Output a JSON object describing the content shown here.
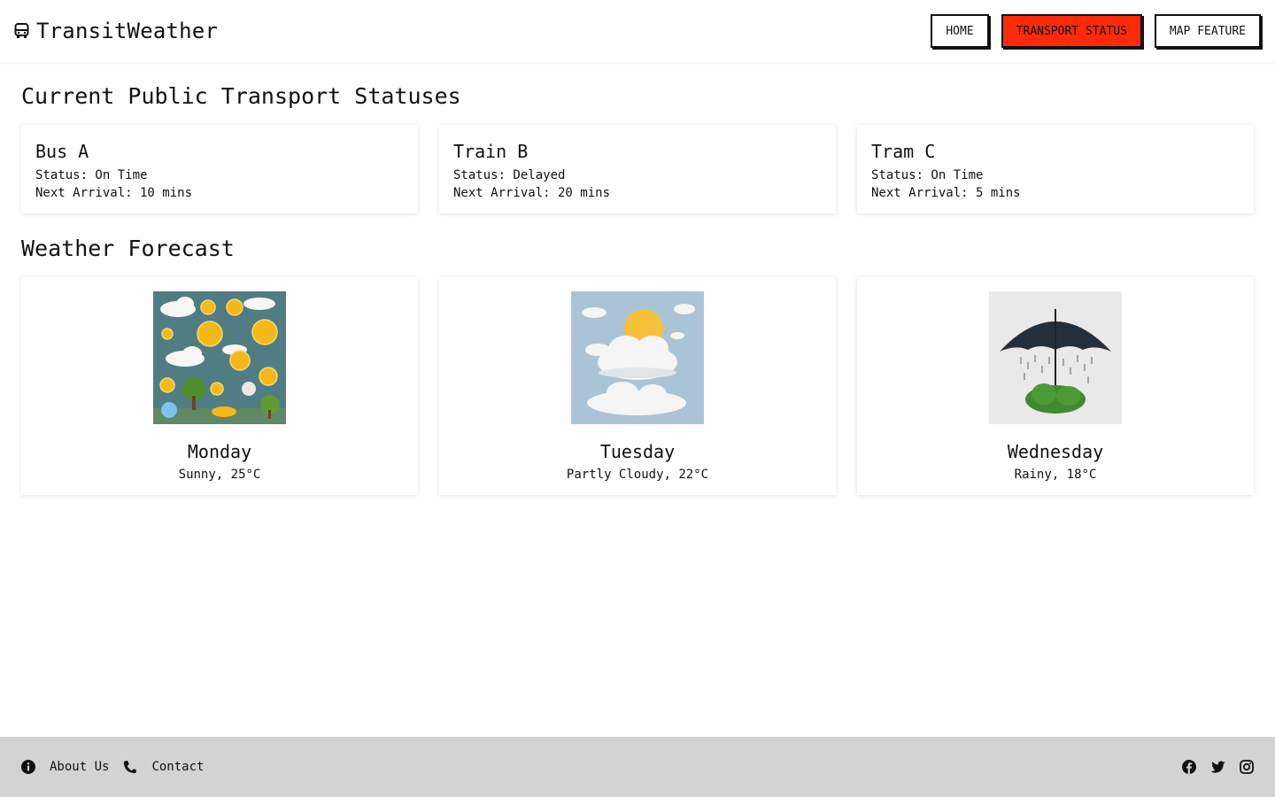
{
  "header": {
    "brand": "TransitWeather",
    "brand_icon": "bus-icon",
    "nav": [
      {
        "label": "HOME",
        "active": false
      },
      {
        "label": "TRANSPORT STATUS",
        "active": true
      },
      {
        "label": "MAP FEATURE",
        "active": false
      }
    ],
    "accent_color": "#ff2a0a"
  },
  "transport": {
    "title": "Current Public Transport Statuses",
    "items": [
      {
        "name": "Bus A",
        "status": "Status: On Time",
        "arrival": "Next Arrival: 10 mins"
      },
      {
        "name": "Train B",
        "status": "Status: Delayed",
        "arrival": "Next Arrival: 20 mins"
      },
      {
        "name": "Tram C",
        "status": "Status: On Time",
        "arrival": "Next Arrival: 5 mins"
      }
    ]
  },
  "weather": {
    "title": "Weather Forecast",
    "days": [
      {
        "day": "Monday",
        "desc": "Sunny, 25°C",
        "icon": "sunny-image"
      },
      {
        "day": "Tuesday",
        "desc": "Partly Cloudy, 22°C",
        "icon": "partly-cloudy-image"
      },
      {
        "day": "Wednesday",
        "desc": "Rainy, 18°C",
        "icon": "rainy-umbrella-image"
      }
    ]
  },
  "footer": {
    "links": [
      {
        "label": "About Us",
        "icon": "info-icon"
      },
      {
        "label": "Contact",
        "icon": "phone-icon"
      }
    ],
    "social": [
      "facebook-icon",
      "twitter-icon",
      "instagram-icon"
    ],
    "background": "#d3d3d3"
  }
}
